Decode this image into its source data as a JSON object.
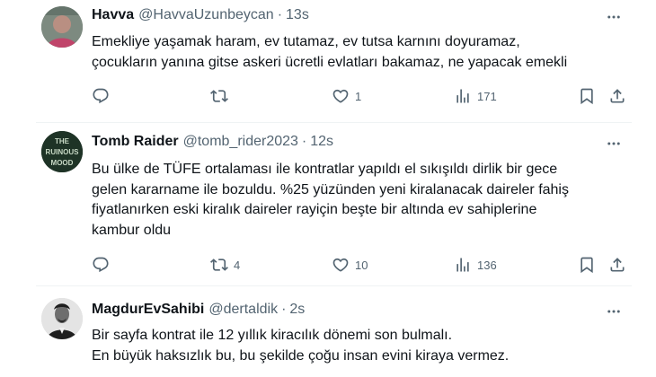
{
  "tweets": [
    {
      "name": "Havva",
      "handle": "@HavvaUzunbeycan",
      "separator": "·",
      "time": "13s",
      "lines": [
        "Emekliye yaşamak haram, ev tutamaz, ev tutsa karnını doyuramaz,",
        "çocukların yanına gitse askeri ücretli evlatları bakamaz, ne yapacak emekli"
      ],
      "reply_count": "",
      "retweet_count": "",
      "like_count": "1",
      "view_count": "171"
    },
    {
      "name": "Tomb Raider",
      "handle": "@tomb_rider2023",
      "separator": "·",
      "time": "12s",
      "avatar_text": "THE RUINOUS MOOD",
      "lines": [
        "Bu ülke de TÜFE ortalaması ile kontratlar yapıldı el sıkışıldı dirlik bir gece",
        "gelen kararname ile bozuldu. %25 yüzünden yeni kiralanacak daireler fahiş",
        "fiyatlanırken eski kiralık daireler rayiçin beşte bir altında ev sahiplerine",
        "kambur oldu"
      ],
      "reply_count": "",
      "retweet_count": "4",
      "like_count": "10",
      "view_count": "136"
    },
    {
      "name": "MagdurEvSahibi",
      "handle": "@dertaldik",
      "separator": "·",
      "time": "2s",
      "lines": [
        "Bir sayfa kontrat ile 12 yıllık kiracılık dönemi son bulmalı.",
        "En büyük haksızlık bu, bu şekilde çoğu insan evini kiraya vermez."
      ]
    }
  ],
  "icons": {
    "more": "more-horizontal-icon",
    "reply": "reply-icon",
    "retweet": "retweet-icon",
    "like": "heart-icon",
    "views": "views-chart-icon",
    "bookmark": "bookmark-icon",
    "share": "share-icon"
  },
  "colors": {
    "text": "#0f1419",
    "secondary": "#536471",
    "divider": "#eff3f4",
    "background": "#ffffff"
  }
}
